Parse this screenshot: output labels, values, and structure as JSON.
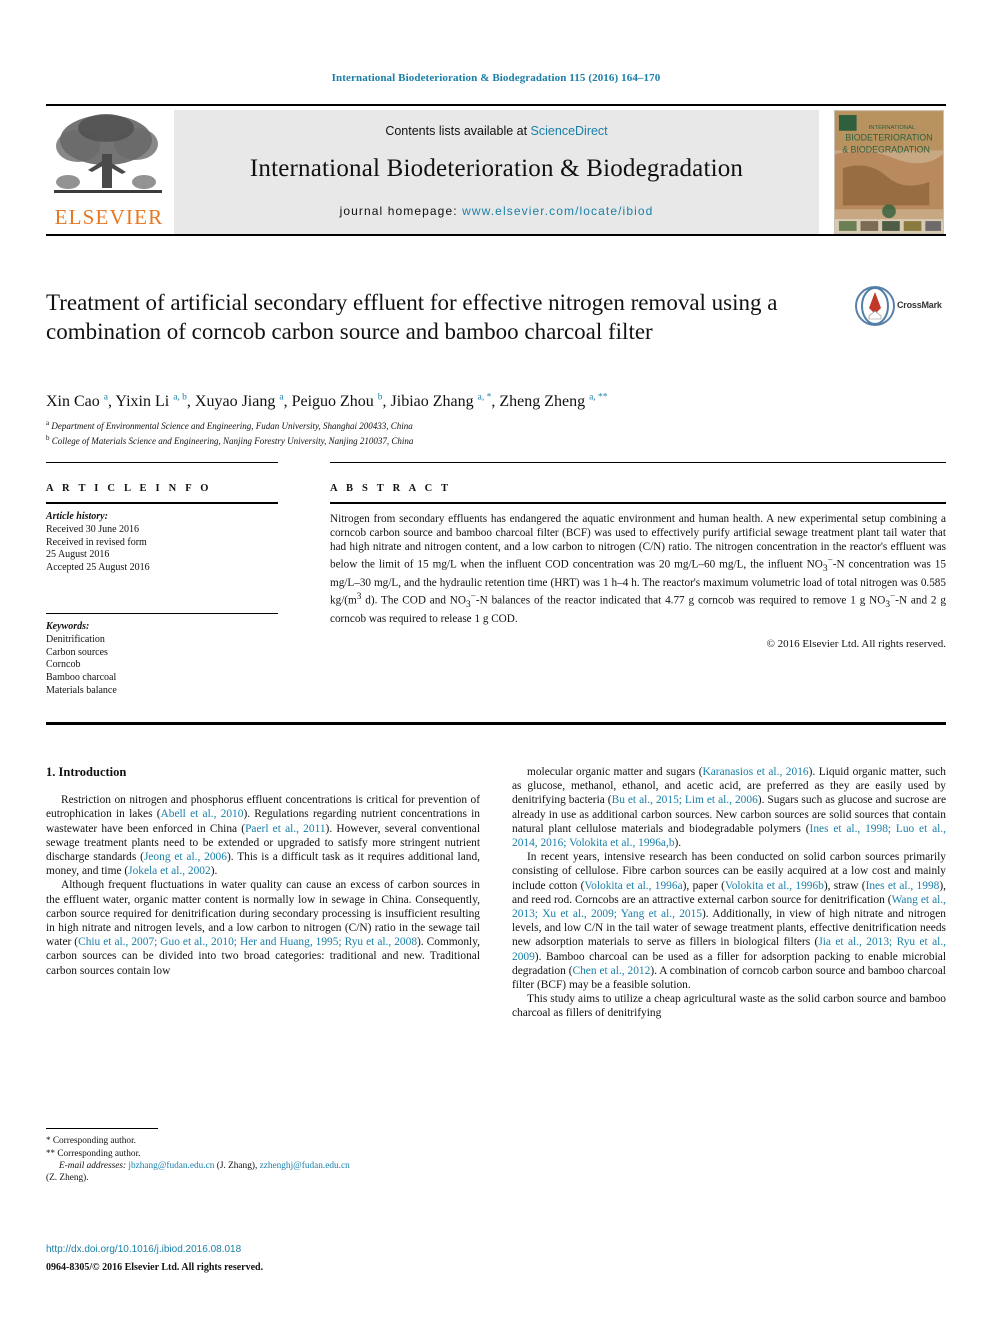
{
  "running_head": "International Biodeterioration & Biodegradation 115 (2016) 164–170",
  "masthead": {
    "publisher_name": "ELSEVIER",
    "contents_prefix": "Contents lists available at ",
    "contents_link": "ScienceDirect",
    "journal_title": "International Biodeterioration & Biodegradation",
    "homepage_prefix": "journal homepage: ",
    "homepage_url": "www.elsevier.com/locate/ibiod",
    "cover_line1": "INTERNATIONAL",
    "cover_line2": "BIODETERIORATION",
    "cover_line3": "& BIODEGRADATION"
  },
  "article": {
    "title": "Treatment of artificial secondary effluent for effective nitrogen removal using a combination of corncob carbon source and bamboo charcoal filter",
    "crossmark_label": "CrossMark",
    "authors_html": "Xin Cao <sup>a</sup>, Yixin Li <sup>a, b</sup>, Xuyao Jiang <sup>a</sup>, Peiguo Zhou <sup>b</sup>, Jibiao Zhang <sup>a, *</sup>, Zheng Zheng <sup>a, **</sup>",
    "affiliation_a": "Department of Environmental Science and Engineering, Fudan University, Shanghai 200433, China",
    "affiliation_b": "College of Materials Science and Engineering, Nanjing Forestry University, Nanjing 210037, China"
  },
  "article_info": {
    "heading": "A R T I C L E   I N F O",
    "history_label": "Article history:",
    "history": [
      "Received 30 June 2016",
      "Received in revised form",
      "25 August 2016",
      "Accepted 25 August 2016"
    ],
    "keywords_label": "Keywords:",
    "keywords": [
      "Denitrification",
      "Carbon sources",
      "Corncob",
      "Bamboo charcoal",
      "Materials balance"
    ]
  },
  "abstract": {
    "heading": "A B S T R A C T",
    "text_html": "Nitrogen from secondary effluents has endangered the aquatic environment and human health. A new experimental setup combining a corncob carbon source and bamboo charcoal filter (BCF) was used to effectively purify artificial sewage treatment plant tail water that had high nitrate and nitrogen content, and a low carbon to nitrogen (C/N) ratio. The nitrogen concentration in the reactor's effluent was below the limit of 15 mg/L when the influent COD concentration was 20 mg/L&ndash;60 mg/L, the influent NO<sub>3</sub><sup>&minus;</sup>-N concentration was 15 mg/L&ndash;30 mg/L, and the hydraulic retention time (HRT) was 1 h&ndash;4 h. The reactor's maximum volumetric load of total nitrogen was 0.585 kg/(m<sup>3</sup> d). The COD and NO<sub>3</sub><sup>&minus;</sup>-N balances of the reactor indicated that 4.77 g corncob was required to remove 1 g NO<sub>3</sub><sup>&minus;</sup>-N and 2 g corncob was required to release 1 g COD.",
    "copyright": "© 2016 Elsevier Ltd. All rights reserved."
  },
  "body": {
    "section_heading": "1. Introduction",
    "left_paragraphs_html": [
      "Restriction on nitrogen and phosphorus effluent concentrations is critical for prevention of eutrophication in lakes (<span class=\"cite\">Abell et al., 2010</span>). Regulations regarding nutrient concentrations in wastewater have been enforced in China (<span class=\"cite\">Paerl et al., 2011</span>). However, several conventional sewage treatment plants need to be extended or upgraded to satisfy more stringent nutrient discharge standards (<span class=\"cite\">Jeong et al., 2006</span>). This is a difficult task as it requires additional land, money, and time (<span class=\"cite\">Jokela et al., 2002</span>).",
      "Although frequent fluctuations in water quality can cause an excess of carbon sources in the effluent water, organic matter content is normally low in sewage in China. Consequently, carbon source required for denitrification during secondary processing is insufficient resulting in high nitrate and nitrogen levels, and a low carbon to nitrogen (C/N) ratio in the sewage tail water (<span class=\"cite\">Chiu et al., 2007; Guo et al., 2010; Her and Huang, 1995; Ryu et al., 2008</span>). Commonly, carbon sources can be divided into two broad categories: traditional and new. Traditional carbon sources contain low"
    ],
    "right_paragraphs_html": [
      "molecular organic matter and sugars (<span class=\"cite\">Karanasios et al., 2016</span>). Liquid organic matter, such as glucose, methanol, ethanol, and acetic acid, are preferred as they are easily used by denitrifying bacteria (<span class=\"cite\">Bu et al., 2015; Lim et al., 2006</span>). Sugars such as glucose and sucrose are already in use as additional carbon sources. New carbon sources are solid sources that contain natural plant cellulose materials and biodegradable polymers (<span class=\"cite\">Ines et al., 1998; Luo et al., 2014, 2016; Volokita et al., 1996a,b</span>).",
      "In recent years, intensive research has been conducted on solid carbon sources primarily consisting of cellulose. Fibre carbon sources can be easily acquired at a low cost and mainly include cotton (<span class=\"cite\">Volokita et al., 1996a</span>), paper (<span class=\"cite\">Volokita et al., 1996b</span>), straw (<span class=\"cite\">Ines et al., 1998</span>), and reed rod. Corncobs are an attractive external carbon source for denitrification (<span class=\"cite\">Wang et al., 2013; Xu et al., 2009; Yang et al., 2015</span>). Additionally, in view of high nitrate and nitrogen levels, and low C/N in the tail water of sewage treatment plants, effective denitrification needs new adsorption materials to serve as fillers in biological filters (<span class=\"cite\">Jia et al., 2013; Ryu et al., 2009</span>). Bamboo charcoal can be used as a filler for adsorption packing to enable microbial degradation (<span class=\"cite\">Chen et al., 2012</span>). A combination of corncob carbon source and bamboo charcoal filter (BCF) may be a feasible solution.",
      "This study aims to utilize a cheap agricultural waste as the solid carbon source and bamboo charcoal as fillers of denitrifying"
    ]
  },
  "footnotes": {
    "corresponding_1": "Corresponding author.",
    "corresponding_2": "Corresponding author.",
    "email_label": "E-mail addresses:",
    "email_1": "jbzhang@fudan.edu.cn",
    "email_1_owner": "(J. Zhang),",
    "email_2": "zzhenghj@fudan.edu.cn",
    "email_2_owner": "(Z. Zheng).",
    "doi": "http://dx.doi.org/10.1016/j.ibiod.2016.08.018",
    "issn_line": "0964-8305/© 2016 Elsevier Ltd. All rights reserved."
  },
  "colors": {
    "link": "#1a7fa8",
    "elsevier_orange": "#e87722",
    "masthead_bg": "#e8e8e8"
  }
}
